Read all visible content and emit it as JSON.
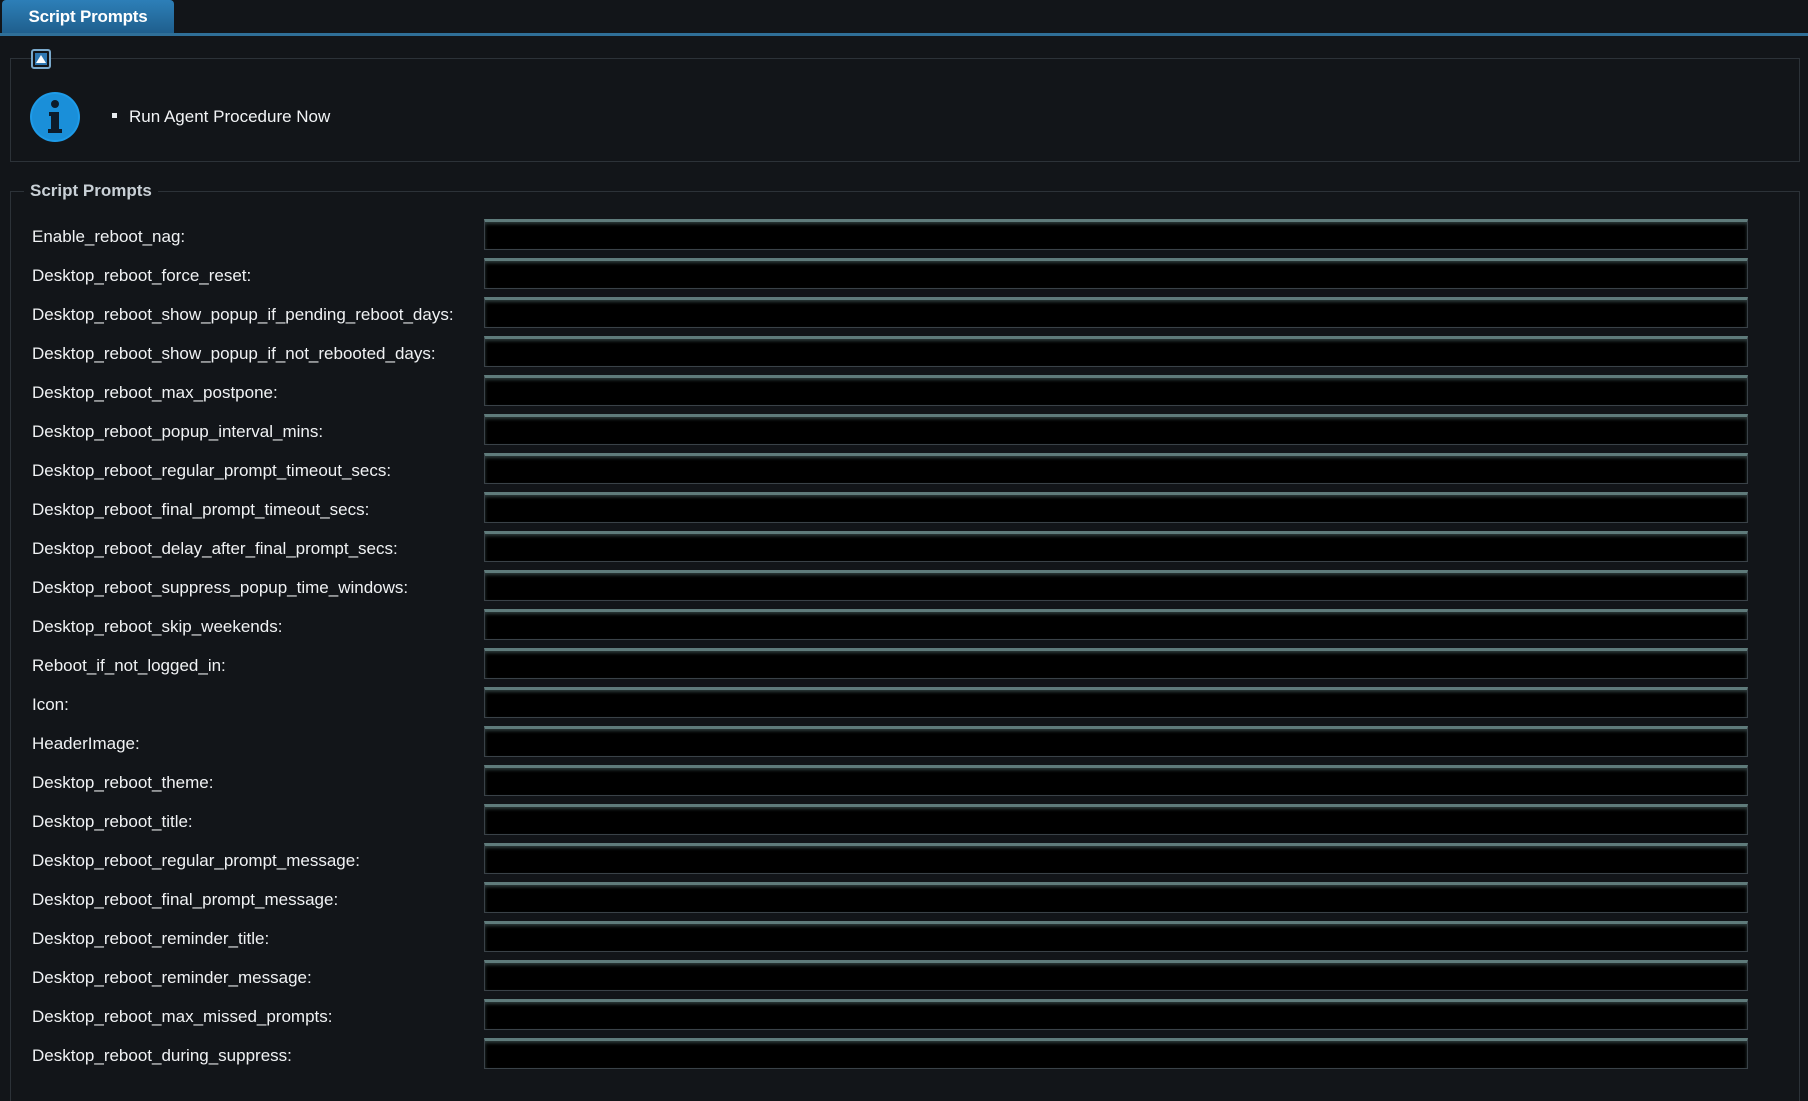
{
  "tab": {
    "label": "Script Prompts"
  },
  "info": {
    "items": [
      "Run Agent Procedure Now"
    ]
  },
  "prompts": {
    "legend": "Script Prompts",
    "fields": [
      {
        "label": "Enable_reboot_nag:",
        "value": ""
      },
      {
        "label": "Desktop_reboot_force_reset:",
        "value": ""
      },
      {
        "label": "Desktop_reboot_show_popup_if_pending_reboot_days:",
        "value": ""
      },
      {
        "label": "Desktop_reboot_show_popup_if_not_rebooted_days:",
        "value": ""
      },
      {
        "label": "Desktop_reboot_max_postpone:",
        "value": ""
      },
      {
        "label": "Desktop_reboot_popup_interval_mins:",
        "value": ""
      },
      {
        "label": "Desktop_reboot_regular_prompt_timeout_secs:",
        "value": ""
      },
      {
        "label": "Desktop_reboot_final_prompt_timeout_secs:",
        "value": ""
      },
      {
        "label": "Desktop_reboot_delay_after_final_prompt_secs:",
        "value": ""
      },
      {
        "label": "Desktop_reboot_suppress_popup_time_windows:",
        "value": ""
      },
      {
        "label": "Desktop_reboot_skip_weekends:",
        "value": ""
      },
      {
        "label": "Reboot_if_not_logged_in:",
        "value": ""
      },
      {
        "label": "Icon:",
        "value": ""
      },
      {
        "label": "HeaderImage:",
        "value": ""
      },
      {
        "label": "Desktop_reboot_theme:",
        "value": ""
      },
      {
        "label": "Desktop_reboot_title:",
        "value": ""
      },
      {
        "label": "Desktop_reboot_regular_prompt_message:",
        "value": ""
      },
      {
        "label": "Desktop_reboot_final_prompt_message:",
        "value": ""
      },
      {
        "label": "Desktop_reboot_reminder_title:",
        "value": ""
      },
      {
        "label": "Desktop_reboot_reminder_message:",
        "value": ""
      },
      {
        "label": "Desktop_reboot_max_missed_prompts:",
        "value": ""
      },
      {
        "label": "Desktop_reboot_during_suppress:",
        "value": ""
      }
    ]
  },
  "colors": {
    "background": "#121519",
    "tab_accent": "#2d7fb8",
    "info_icon": "#1e9be8"
  }
}
